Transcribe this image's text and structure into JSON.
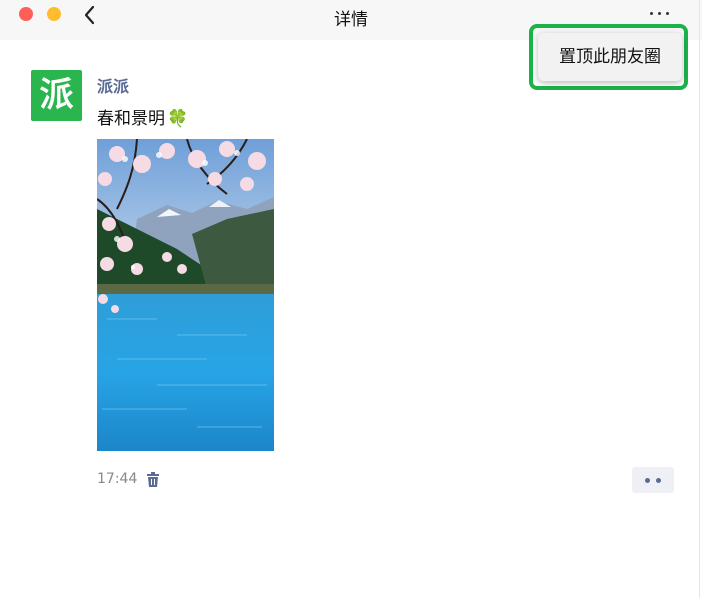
{
  "window": {
    "title": "详情",
    "traffic_lights": {
      "close_color": "#ff5f57",
      "minimize_color": "#febc2e"
    }
  },
  "post": {
    "avatar_char": "派",
    "avatar_color": "#2bb54f",
    "author": "派派",
    "text": "春和景明",
    "emoji": "🍀",
    "time": "17:44",
    "photo": "cherry-blossom-lake-mountain-photo"
  },
  "popup_menu": {
    "items": [
      {
        "label": "置顶此朋友圈"
      }
    ],
    "highlight_color": "#1bb24a"
  },
  "colors": {
    "author_name": "#5a6b94",
    "titlebar": "#f7f7f7"
  }
}
